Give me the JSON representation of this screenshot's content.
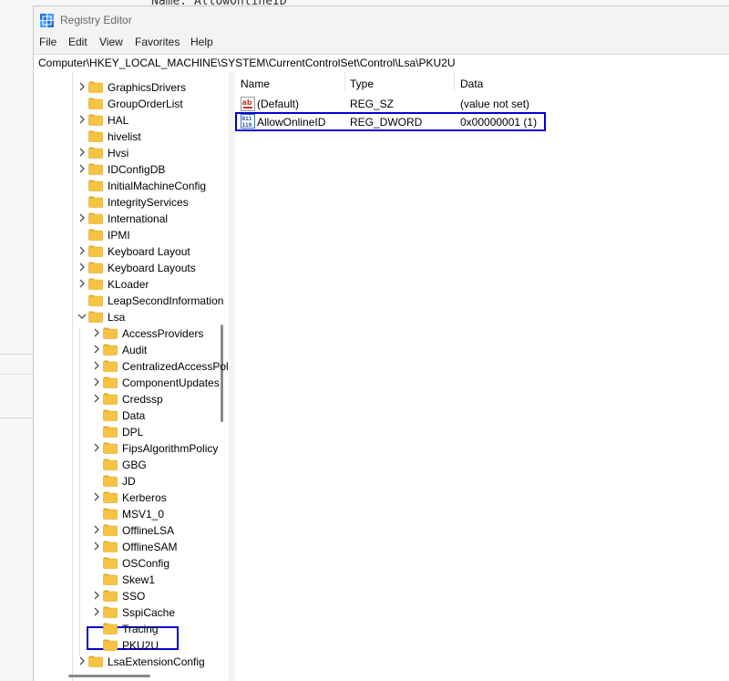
{
  "background": {
    "top_text": "Name: AllowOnlineID"
  },
  "window": {
    "title": "Registry Editor"
  },
  "menu": [
    "File",
    "Edit",
    "View",
    "Favorites",
    "Help"
  ],
  "address": "Computer\\HKEY_LOCAL_MACHINE\\SYSTEM\\CurrentControlSet\\Control\\Lsa\\PKU2U",
  "tree": {
    "items": [
      {
        "label": "GraphicsDrivers",
        "level": 0,
        "expander": "collapsed"
      },
      {
        "label": "GroupOrderList",
        "level": 0,
        "expander": "none"
      },
      {
        "label": "HAL",
        "level": 0,
        "expander": "collapsed"
      },
      {
        "label": "hivelist",
        "level": 0,
        "expander": "none"
      },
      {
        "label": "Hvsi",
        "level": 0,
        "expander": "collapsed"
      },
      {
        "label": "IDConfigDB",
        "level": 0,
        "expander": "collapsed"
      },
      {
        "label": "InitialMachineConfig",
        "level": 0,
        "expander": "none"
      },
      {
        "label": "IntegrityServices",
        "level": 0,
        "expander": "none"
      },
      {
        "label": "International",
        "level": 0,
        "expander": "collapsed"
      },
      {
        "label": "IPMI",
        "level": 0,
        "expander": "none"
      },
      {
        "label": "Keyboard Layout",
        "level": 0,
        "expander": "collapsed"
      },
      {
        "label": "Keyboard Layouts",
        "level": 0,
        "expander": "collapsed"
      },
      {
        "label": "KLoader",
        "level": 0,
        "expander": "collapsed"
      },
      {
        "label": "LeapSecondInformation",
        "level": 0,
        "expander": "none"
      },
      {
        "label": "Lsa",
        "level": 0,
        "expander": "expanded"
      },
      {
        "label": "AccessProviders",
        "level": 1,
        "expander": "collapsed"
      },
      {
        "label": "Audit",
        "level": 1,
        "expander": "collapsed"
      },
      {
        "label": "CentralizedAccessPolicies",
        "level": 1,
        "expander": "collapsed"
      },
      {
        "label": "ComponentUpdates",
        "level": 1,
        "expander": "collapsed"
      },
      {
        "label": "Credssp",
        "level": 1,
        "expander": "collapsed"
      },
      {
        "label": "Data",
        "level": 1,
        "expander": "none"
      },
      {
        "label": "DPL",
        "level": 1,
        "expander": "none"
      },
      {
        "label": "FipsAlgorithmPolicy",
        "level": 1,
        "expander": "collapsed"
      },
      {
        "label": "GBG",
        "level": 1,
        "expander": "none"
      },
      {
        "label": "JD",
        "level": 1,
        "expander": "none"
      },
      {
        "label": "Kerberos",
        "level": 1,
        "expander": "collapsed"
      },
      {
        "label": "MSV1_0",
        "level": 1,
        "expander": "none"
      },
      {
        "label": "OfflineLSA",
        "level": 1,
        "expander": "collapsed"
      },
      {
        "label": "OfflineSAM",
        "level": 1,
        "expander": "collapsed"
      },
      {
        "label": "OSConfig",
        "level": 1,
        "expander": "none"
      },
      {
        "label": "Skew1",
        "level": 1,
        "expander": "none"
      },
      {
        "label": "SSO",
        "level": 1,
        "expander": "collapsed"
      },
      {
        "label": "SspiCache",
        "level": 1,
        "expander": "collapsed"
      },
      {
        "label": "Tracing",
        "level": 1,
        "expander": "none"
      },
      {
        "label": "PKU2U",
        "level": 1,
        "expander": "none",
        "selected": true
      },
      {
        "label": "LsaExtensionConfig",
        "level": 0,
        "expander": "collapsed"
      }
    ]
  },
  "list": {
    "columns": [
      "Name",
      "Type",
      "Data"
    ],
    "rows": [
      {
        "name": "(Default)",
        "type": "REG_SZ",
        "data": "(value not set)",
        "icon": "string-value-icon"
      },
      {
        "name": "AllowOnlineID",
        "type": "REG_DWORD",
        "data": "0x00000001 (1)",
        "icon": "binary-value-icon",
        "highlighted": true
      }
    ]
  },
  "colors": {
    "highlight_border": "#0000cc",
    "folder": "#f6c343",
    "chevron": "#505050"
  }
}
